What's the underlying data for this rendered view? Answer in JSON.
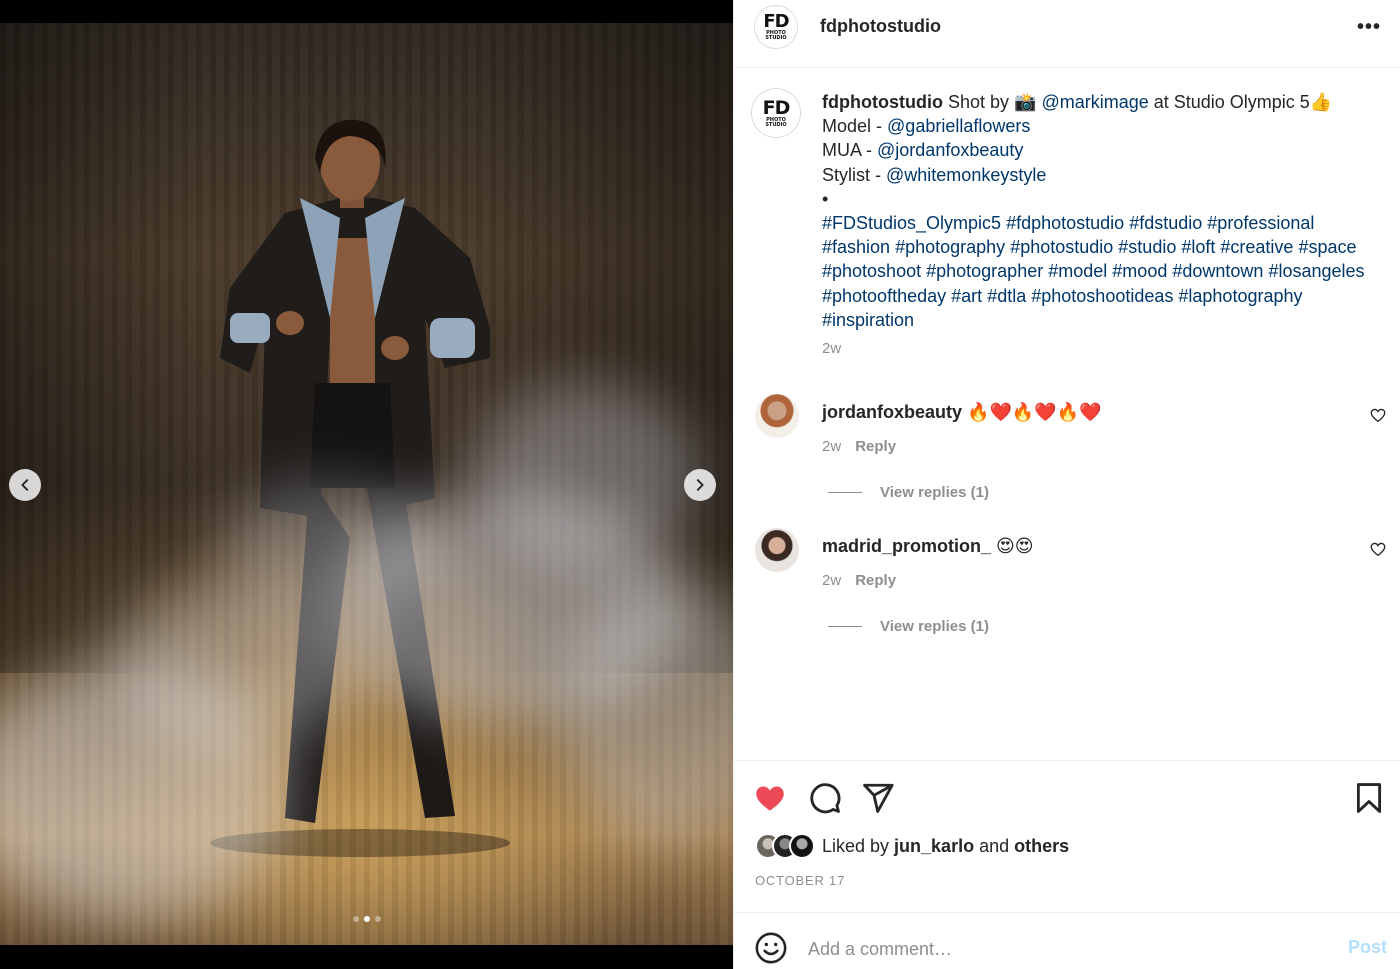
{
  "post": {
    "username": "fdphotostudio",
    "more_label": "•••",
    "logo_text": "FD",
    "logo_sub1": "PHOTO",
    "logo_sub2": "STUDIO"
  },
  "caption": {
    "username": "fdphotostudio",
    "line1_prefix": " Shot by 📸 ",
    "line1_mention": "@markimage",
    "line1_suffix": " at Studio Olympic 5👍",
    "model_label": "Model - ",
    "model_mention": "@gabriellaflowers",
    "mua_label": "MUA - ",
    "mua_mention": "@jordanfoxbeauty",
    "stylist_label": "Stylist - ",
    "stylist_mention": "@whitemonkeystyle",
    "bullet": "•",
    "hashtags": "#FDStudios_Olympic5 #fdphotostudio #fdstudio #professional #fashion #photography #photostudio #studio #loft #creative #space #photoshoot #photographer #model #mood #downtown #losangeles #photooftheday #art #dtla #photoshootideas #laphotography #inspiration",
    "time": "2w"
  },
  "comments": [
    {
      "username": "jordanfoxbeauty",
      "text": " 🔥❤️🔥❤️🔥❤️",
      "time": "2w",
      "reply_label": "Reply",
      "view_replies": "View replies (1)"
    },
    {
      "username": "madrid_promotion_",
      "text": " 😍😍",
      "time": "2w",
      "reply_label": "Reply",
      "view_replies": "View replies (1)"
    }
  ],
  "likes": {
    "prefix": "Liked by ",
    "user": "jun_karlo",
    "middle": " and ",
    "others": "others"
  },
  "date": "OCTOBER 17",
  "add_comment": {
    "placeholder": "Add a comment…",
    "post_label": "Post"
  },
  "carousel": {
    "total": 3,
    "active_index": 1
  },
  "colors": {
    "liked_heart": "#ed4956",
    "link": "#00376b",
    "post_disabled": "#b2dffc"
  }
}
